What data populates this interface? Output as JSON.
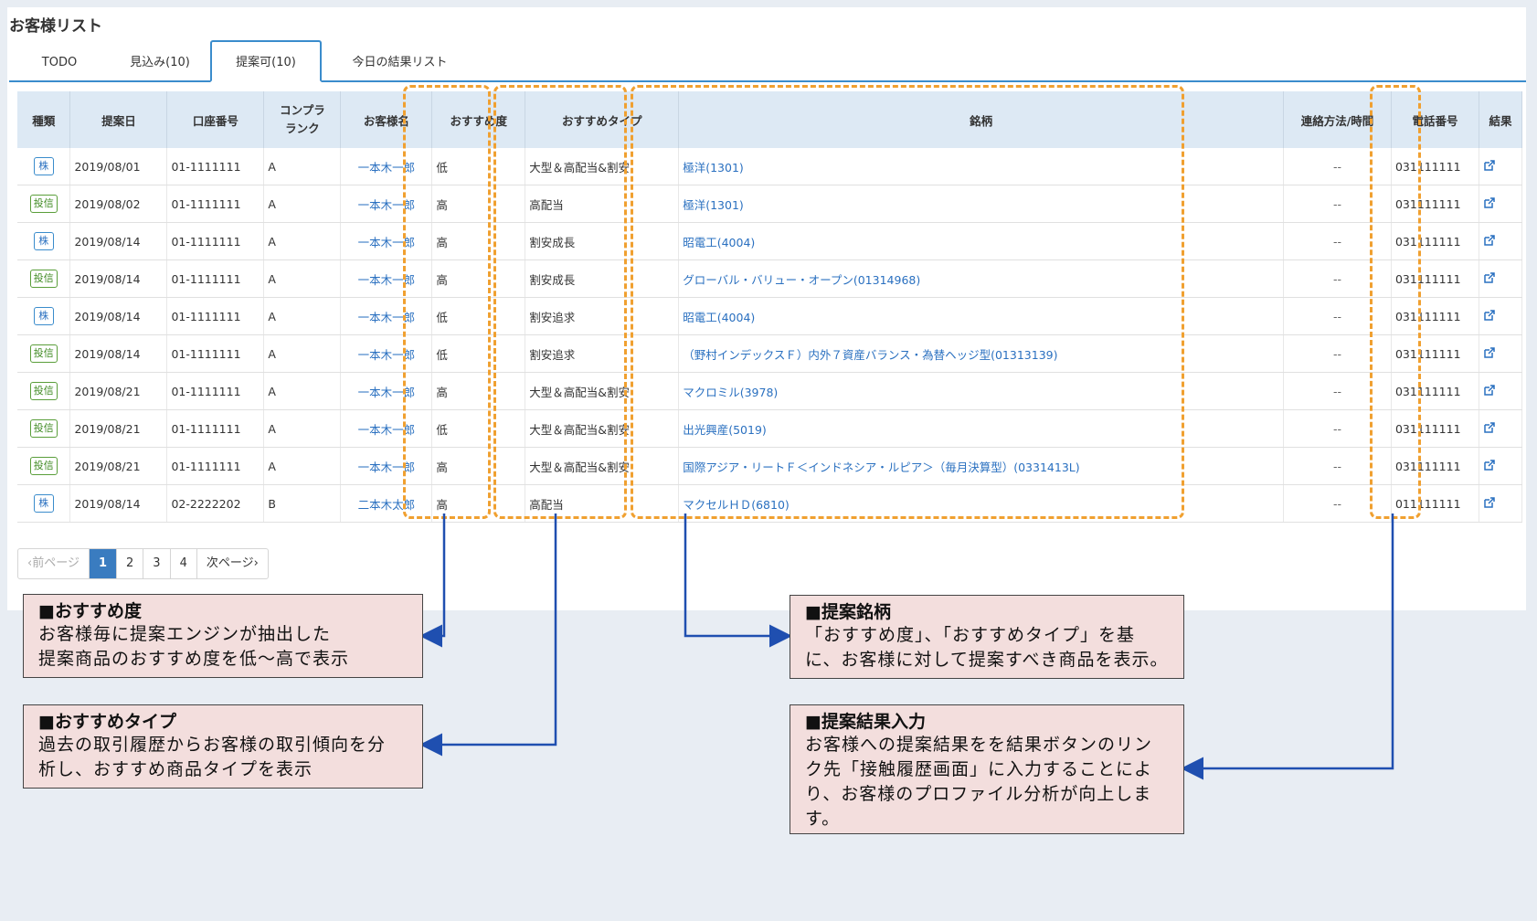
{
  "page_title": "お客様リスト",
  "tabs": [
    {
      "label": "TODO"
    },
    {
      "label": "見込み(10)"
    },
    {
      "label": "提案可(10)"
    },
    {
      "label": "今日の結果リスト"
    }
  ],
  "table": {
    "headers": [
      "種類",
      "提案日",
      "口座番号",
      "コンプラ\nランク",
      "お客様名",
      "おすすめ度",
      "おすすめタイプ",
      "銘柄",
      "連絡方法/時間",
      "電話番号",
      "結果"
    ],
    "rows": [
      {
        "kind": "株",
        "date": "2019/08/01",
        "account": "01-1111111",
        "rank": "A",
        "name": "一本木一郎",
        "level": "低",
        "type": "大型＆高配当&割安",
        "stock": "極洋(1301)",
        "contact": "--",
        "phone": "031111111"
      },
      {
        "kind": "投信",
        "date": "2019/08/02",
        "account": "01-1111111",
        "rank": "A",
        "name": "一本木一郎",
        "level": "高",
        "type": "高配当",
        "stock": "極洋(1301)",
        "contact": "--",
        "phone": "031111111"
      },
      {
        "kind": "株",
        "date": "2019/08/14",
        "account": "01-1111111",
        "rank": "A",
        "name": "一本木一郎",
        "level": "高",
        "type": "割安成長",
        "stock": "昭電工(4004)",
        "contact": "--",
        "phone": "031111111"
      },
      {
        "kind": "投信",
        "date": "2019/08/14",
        "account": "01-1111111",
        "rank": "A",
        "name": "一本木一郎",
        "level": "高",
        "type": "割安成長",
        "stock": "グローバル・バリュー・オープン(01314968)",
        "contact": "--",
        "phone": "031111111"
      },
      {
        "kind": "株",
        "date": "2019/08/14",
        "account": "01-1111111",
        "rank": "A",
        "name": "一本木一郎",
        "level": "低",
        "type": "割安追求",
        "stock": "昭電工(4004)",
        "contact": "--",
        "phone": "031111111"
      },
      {
        "kind": "投信",
        "date": "2019/08/14",
        "account": "01-1111111",
        "rank": "A",
        "name": "一本木一郎",
        "level": "低",
        "type": "割安追求",
        "stock": "（野村インデックスＦ）内外７資産バランス・為替ヘッジ型(01313139)",
        "contact": "--",
        "phone": "031111111"
      },
      {
        "kind": "投信",
        "date": "2019/08/21",
        "account": "01-1111111",
        "rank": "A",
        "name": "一本木一郎",
        "level": "高",
        "type": "大型＆高配当&割安",
        "stock": "マクロミル(3978)",
        "contact": "--",
        "phone": "031111111"
      },
      {
        "kind": "投信",
        "date": "2019/08/21",
        "account": "01-1111111",
        "rank": "A",
        "name": "一本木一郎",
        "level": "低",
        "type": "大型＆高配当&割安",
        "stock": "出光興産(5019)",
        "contact": "--",
        "phone": "031111111"
      },
      {
        "kind": "投信",
        "date": "2019/08/21",
        "account": "01-1111111",
        "rank": "A",
        "name": "一本木一郎",
        "level": "高",
        "type": "大型＆高配当&割安",
        "stock": "国際アジア・リートＦ＜インドネシア・ルピア＞（毎月決算型）(0331413L)",
        "contact": "--",
        "phone": "031111111"
      },
      {
        "kind": "株",
        "date": "2019/08/14",
        "account": "02-2222202",
        "rank": "B",
        "name": "二本木太郎",
        "level": "高",
        "type": "高配当",
        "stock": "マクセルＨＤ(6810)",
        "contact": "--",
        "phone": "011111111"
      }
    ]
  },
  "pagination": {
    "prev": "‹前ページ",
    "pages": [
      "1",
      "2",
      "3",
      "4"
    ],
    "current": "1",
    "next": "次ページ›"
  },
  "notes": {
    "recommend_level": {
      "title": "■おすすめ度",
      "lines": [
        "お客様毎に提案エンジンが抽出した",
        "提案商品のおすすめ度を低〜高で表示"
      ]
    },
    "recommend_type": {
      "title": "■おすすめタイプ",
      "lines": [
        "過去の取引履歴からお客様の取引傾向を分",
        "析し、おすすめ商品タイプを表示"
      ]
    },
    "proposal_stock": {
      "title": "■提案銘柄",
      "lines": [
        "「おすすめ度」、「おすすめタイプ」を基",
        "に、お客様に対して提案すべき商品を表示。"
      ]
    },
    "result_input": {
      "title": "■提案結果入力",
      "lines": [
        "お客様への提案結果をを結果ボタンのリン",
        "ク先「接触履歴画面」に入力することによ",
        "り、お客様のプロファイル分析が向上しま",
        "す。"
      ]
    }
  },
  "colors": {
    "accent": "#3a8ccc",
    "highlight_box": "#f0a030",
    "note_bg": "#f3dedd",
    "arrow": "#1f4fb0"
  },
  "icons": {
    "result": "external-link-icon"
  }
}
